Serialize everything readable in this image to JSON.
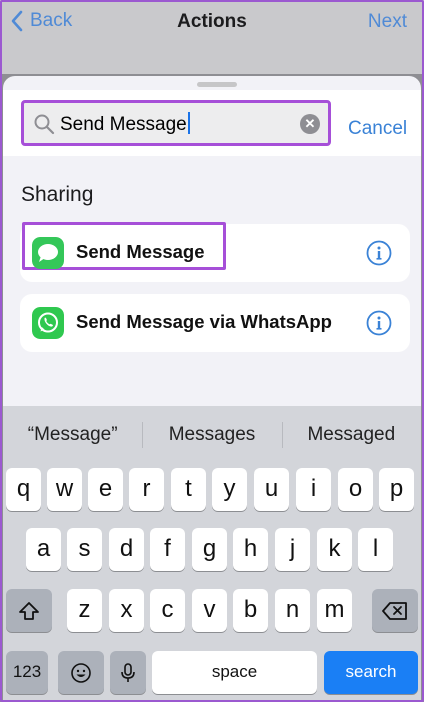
{
  "nav": {
    "back": "Back",
    "title": "Actions",
    "next": "Next"
  },
  "search": {
    "query": "Send Message",
    "cancel": "Cancel"
  },
  "section": {
    "title": "Sharing"
  },
  "results": [
    {
      "label": "Send Message",
      "icon": "messages-app-icon"
    },
    {
      "label": "Send Message via WhatsApp",
      "icon": "whatsapp-app-icon"
    }
  ],
  "suggestions": [
    "“Message”",
    "Messages",
    "Messaged"
  ],
  "keyboard": {
    "row1": [
      "q",
      "w",
      "e",
      "r",
      "t",
      "y",
      "u",
      "i",
      "o",
      "p"
    ],
    "row2": [
      "a",
      "s",
      "d",
      "f",
      "g",
      "h",
      "j",
      "k",
      "l"
    ],
    "row3": [
      "z",
      "x",
      "c",
      "v",
      "b",
      "n",
      "m"
    ],
    "numbers": "123",
    "space": "space",
    "search": "search"
  },
  "colors": {
    "accent": "#3a82d6",
    "highlight": "#a64fd8",
    "search_key": "#1a7ff5"
  }
}
